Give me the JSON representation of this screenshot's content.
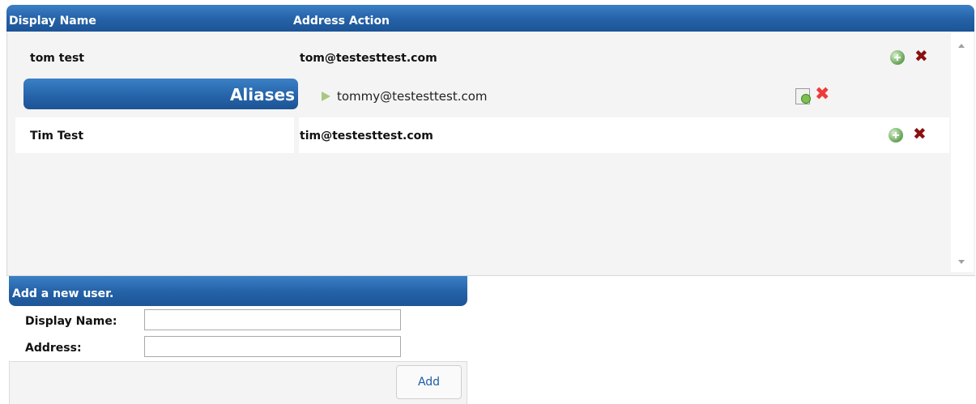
{
  "table": {
    "headers": {
      "display_name": "Display Name",
      "address_action": "Address Action"
    },
    "users": [
      {
        "name": "tom test",
        "address": "tom@testesttest.com"
      },
      {
        "name": "Tim Test",
        "address": "tim@testesttest.com"
      }
    ],
    "aliases": {
      "label": "Aliases",
      "items": [
        {
          "address": "tommy@testesttest.com"
        }
      ]
    },
    "icons": {
      "add": "add-circle-icon",
      "delete": "delete-x-icon",
      "edit": "edit-note-icon",
      "expand": "play-arrow-icon"
    }
  },
  "add_user_form": {
    "title": "Add a new user.",
    "display_name_label": "Display Name:",
    "display_name_value": "",
    "address_label": "Address:",
    "address_value": "",
    "submit_label": "Add"
  },
  "colors": {
    "header_blue": "#2461a6",
    "delete_dark": "#8a1010",
    "delete_red": "#ef3a3a",
    "add_green": "#7ab36a"
  }
}
